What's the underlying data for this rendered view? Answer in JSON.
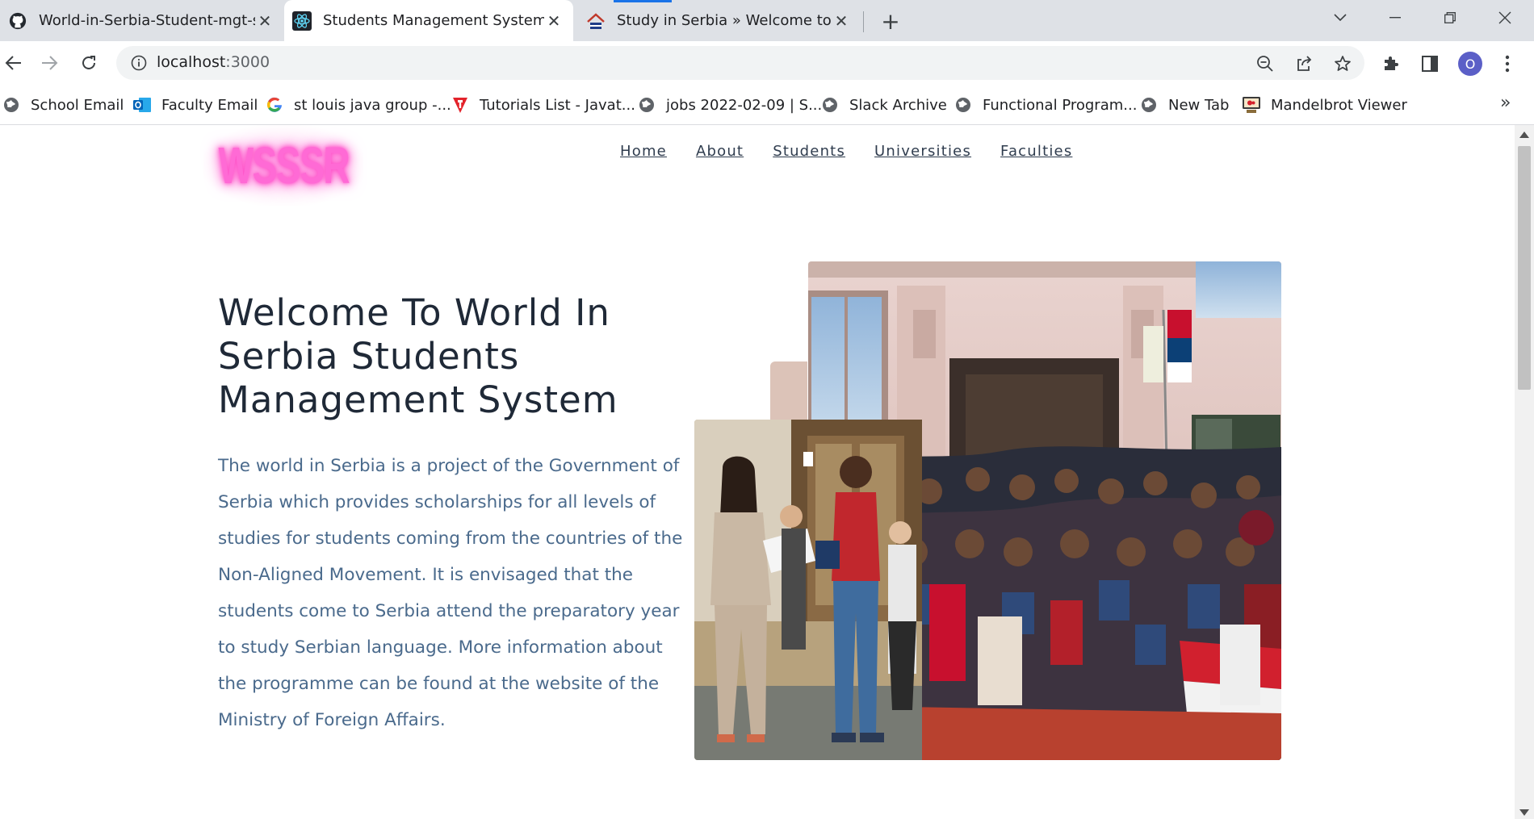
{
  "browser": {
    "tabs": [
      {
        "title": "World-in-Serbia-Student-mgt-sy",
        "icon": "github-icon",
        "active": false
      },
      {
        "title": "Students Management System",
        "icon": "react-icon",
        "active": true
      },
      {
        "title": "Study in Serbia » Welcome to Ser",
        "icon": "study-in-serbia-icon",
        "active": false
      }
    ],
    "url_host": "localhost",
    "url_port": ":3000",
    "profile_initial": "O",
    "bookmarks": [
      {
        "label": "School Email",
        "icon": "globe-icon"
      },
      {
        "label": "Faculty Email",
        "icon": "outlook-icon"
      },
      {
        "label": "st louis java group -...",
        "icon": "google-icon"
      },
      {
        "label": "Tutorials List - Javat...",
        "icon": "javatpoint-icon"
      },
      {
        "label": "jobs 2022-02-09 | S...",
        "icon": "globe-icon"
      },
      {
        "label": "Slack Archive",
        "icon": "globe-icon"
      },
      {
        "label": "Functional Program...",
        "icon": "globe-icon"
      },
      {
        "label": "New Tab",
        "icon": "globe-icon"
      },
      {
        "label": "Mandelbrot Viewer",
        "icon": "mandelbrot-icon"
      }
    ]
  },
  "site": {
    "logo_text": "WSSSR",
    "logo_color": "#ff6ad5",
    "nav": [
      "Home",
      "About",
      "Students",
      "Universities",
      "Faculties"
    ],
    "hero": {
      "title": "Welcome To World In Serbia Students Management System",
      "text": "The world in Serbia is a project of the Government of Serbia which provides scholarships for all levels of studies for students coming from the countries of the Non-Aligned Movement. It is envisaged that the students come to Serbia attend the preparatory year to study Serbian language. More information about the programme can be found at the website of the Ministry of Foreign Affairs."
    },
    "colors": {
      "title": "#1f2937",
      "text": "#4a6a8c",
      "accent_block": "#dcc3b8"
    }
  }
}
